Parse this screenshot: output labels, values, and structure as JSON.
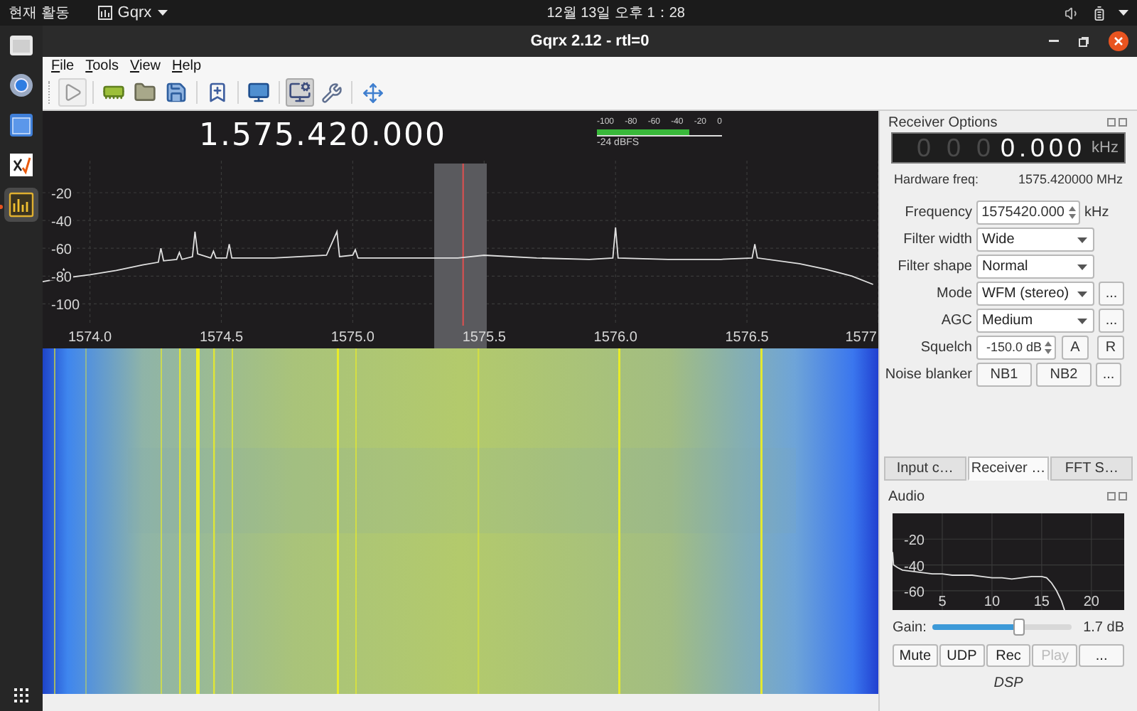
{
  "top_bar": {
    "activities": "현재 활동",
    "app_menu": "Gqrx",
    "clock": "12월 13일 오후 1：28"
  },
  "dock": [
    {
      "kind": "files",
      "selected": false
    },
    {
      "kind": "browser",
      "selected": false
    },
    {
      "kind": "window",
      "selected": false
    },
    {
      "kind": "math",
      "selected": false
    },
    {
      "kind": "spectrum",
      "selected": true
    }
  ],
  "window": {
    "title": "Gqrx 2.12 - rtl=0"
  },
  "menu": [
    "File",
    "Tools",
    "View",
    "Help"
  ],
  "toolbar": [
    [
      {
        "kind": "play",
        "selected": false
      }
    ],
    [
      {
        "kind": "device",
        "selected": false
      },
      {
        "kind": "open",
        "selected": false
      },
      {
        "kind": "save",
        "selected": false
      }
    ],
    [
      {
        "kind": "bookmark",
        "selected": false
      }
    ],
    [
      {
        "kind": "display",
        "selected": false
      }
    ],
    [
      {
        "kind": "remote",
        "selected": true
      },
      {
        "kind": "tools",
        "selected": false
      }
    ],
    [
      {
        "kind": "move",
        "selected": false
      }
    ]
  ],
  "plotter": {
    "frequency": "1.575.420.000",
    "meter": {
      "scale": [
        "-100",
        "-80",
        "-60",
        "-40",
        "-20",
        "0"
      ],
      "level": 0.74,
      "reading": "-24 dBFS"
    },
    "spectrum": {
      "chart_data": {
        "type": "line",
        "grid": true,
        "xlim": [
          1573.82,
          1577
        ],
        "ylim": [
          -132,
          3
        ],
        "bands": [
          {
            "axis": "x",
            "from": 1575.31,
            "to": 1575.51,
            "color": "#5a5a5e"
          }
        ],
        "ref_lines": [
          {
            "axis": "x",
            "value": 1575.42,
            "color": "#e05050"
          }
        ],
        "xticks": [
          {
            "value": 1574,
            "label": "1574.0"
          },
          {
            "value": 1574.5,
            "label": "1574.5"
          },
          {
            "value": 1575,
            "label": "1575.0"
          },
          {
            "value": 1575.5,
            "label": "1575.5"
          },
          {
            "value": 1576,
            "label": "1576.0"
          },
          {
            "value": 1576.5,
            "label": "1576.5"
          },
          {
            "value": 1577,
            "label": "1577"
          }
        ],
        "yticks": [
          -20,
          -40,
          -60,
          -80,
          -100
        ],
        "x": [
          1573.82,
          1573.88,
          1573.9,
          1573.92,
          1574.0,
          1574.1,
          1574.2,
          1574.26,
          1574.27,
          1574.28,
          1574.33,
          1574.34,
          1574.35,
          1574.39,
          1574.4,
          1574.41,
          1574.46,
          1574.47,
          1574.48,
          1574.52,
          1574.53,
          1574.54,
          1574.7,
          1574.9,
          1574.94,
          1574.95,
          1575.0,
          1575.01,
          1575.02,
          1575.2,
          1575.4,
          1575.5,
          1575.7,
          1575.9,
          1575.99,
          1576.0,
          1576.01,
          1576.2,
          1576.4,
          1576.52,
          1576.53,
          1576.54,
          1576.7,
          1576.8,
          1576.9,
          1576.98
        ],
        "series": [
          {
            "color": "#e0e0e0",
            "values": [
              -84,
              -82,
              -75,
              -81,
              -79,
              -76,
              -72,
              -70,
              -60,
              -69,
              -68,
              -63,
              -68,
              -66,
              -48,
              -64,
              -67,
              -62,
              -67,
              -67,
              -57,
              -67,
              -67,
              -65,
              -48,
              -66,
              -65,
              -61,
              -67,
              -67,
              -67,
              -65,
              -67,
              -68,
              -67,
              -45,
              -67,
              -68,
              -68,
              -67,
              -57,
              -67,
              -71,
              -75,
              -80,
              -86
            ]
          }
        ]
      }
    }
  },
  "receiver_options": {
    "title": "Receiver Options",
    "display": {
      "dim": "0 0 0",
      "digits": "0.000",
      "unit": "kHz"
    },
    "hardware_freq": {
      "label": "Hardware freq:",
      "value": "1575.420000 MHz"
    },
    "fields": [
      {
        "kind": "spinbox",
        "label": "Frequency",
        "value": "1575420.000",
        "unit": "kHz"
      },
      {
        "kind": "select",
        "label": "Filter width",
        "value": "Wide"
      },
      {
        "kind": "select",
        "label": "Filter shape",
        "value": "Normal"
      },
      {
        "kind": "select",
        "label": "Mode",
        "value": "WFM (stereo)",
        "buttons": [
          "..."
        ]
      },
      {
        "kind": "select",
        "label": "AGC",
        "value": "Medium",
        "buttons": [
          "..."
        ]
      },
      {
        "kind": "squelch",
        "label": "Squelch",
        "value": "-150.0 dB",
        "buttons": [
          "A",
          "R"
        ]
      },
      {
        "kind": "buttons",
        "label": "Noise blanker",
        "buttons": [
          "NB1",
          "NB2",
          "..."
        ]
      }
    ]
  },
  "dock_tabs": [
    {
      "label": "Input c…",
      "selected": false
    },
    {
      "label": "Receiver …",
      "selected": true
    },
    {
      "label": "FFT S…",
      "selected": false
    }
  ],
  "audio": {
    "title": "Audio",
    "chart_data": {
      "type": "line",
      "grid": true,
      "xlim": [
        0,
        23.3
      ],
      "ylim": [
        -75,
        0
      ],
      "xticks": [
        5,
        10,
        15,
        20
      ],
      "yticks": [
        -20,
        -40,
        -60
      ],
      "x": [
        0,
        0.1,
        0.5,
        1,
        2,
        3,
        4,
        5,
        6,
        7,
        8,
        9,
        10,
        11,
        12,
        13,
        14,
        15,
        15.5,
        16,
        16.5,
        17,
        17.3
      ],
      "series": [
        {
          "color": "#e0e0e0",
          "values": [
            -30,
            -40,
            -42,
            -44,
            -45,
            -46,
            -47,
            -47,
            -48,
            -48,
            -48,
            -49,
            -50,
            -50,
            -51,
            -50,
            -49,
            -49,
            -50,
            -54,
            -60,
            -68,
            -75
          ]
        }
      ]
    },
    "gain": {
      "label": "Gain:",
      "level": 0.62,
      "reading": "1.7 dB"
    },
    "buttons": [
      {
        "label": "Mute",
        "disabled": false
      },
      {
        "label": "UDP",
        "disabled": false
      },
      {
        "label": "Rec",
        "disabled": false
      },
      {
        "label": "Play",
        "disabled": true
      },
      {
        "label": "...",
        "disabled": false
      }
    ],
    "footer": "DSP"
  }
}
